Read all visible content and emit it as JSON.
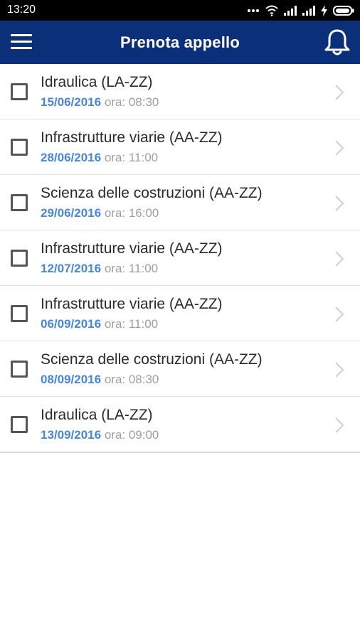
{
  "status_bar": {
    "time": "13:20",
    "icons": [
      "more-dots-icon",
      "wifi-icon",
      "signal-icon",
      "signal-icon",
      "charging-icon",
      "battery-icon"
    ]
  },
  "app_bar": {
    "title": "Prenota appello",
    "menu_icon": "hamburger-menu-icon",
    "notification_icon": "bell-icon"
  },
  "colors": {
    "app_bar": "#0b2f79",
    "date": "#4a86d4",
    "time_text": "#9e9e9e"
  },
  "exams": [
    {
      "course": "Idraulica (LA-ZZ)",
      "date": "15/06/2016",
      "time": "ora: 08:30"
    },
    {
      "course": "Infrastrutture viarie (AA-ZZ)",
      "date": "28/06/2016",
      "time": "ora: 11:00"
    },
    {
      "course": "Scienza delle costruzioni (AA-ZZ)",
      "date": "29/06/2016",
      "time": "ora: 16:00"
    },
    {
      "course": "Infrastrutture viarie (AA-ZZ)",
      "date": "12/07/2016",
      "time": "ora: 11:00"
    },
    {
      "course": "Infrastrutture viarie (AA-ZZ)",
      "date": "06/09/2016",
      "time": "ora: 11:00"
    },
    {
      "course": "Scienza delle costruzioni (AA-ZZ)",
      "date": "08/09/2016",
      "time": "ora: 08:30"
    },
    {
      "course": "Idraulica (LA-ZZ)",
      "date": "13/09/2016",
      "time": "ora: 09:00"
    }
  ]
}
